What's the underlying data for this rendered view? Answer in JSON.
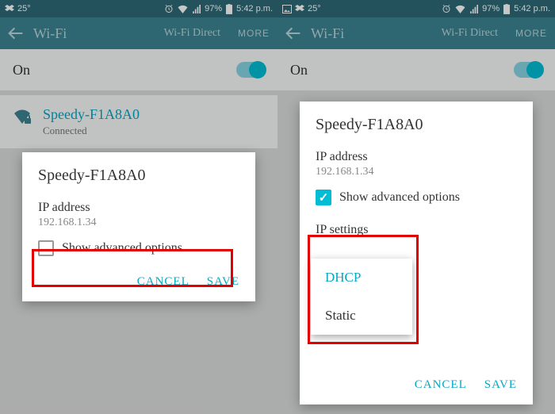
{
  "statusbar": {
    "temp": "25°",
    "battery": "97%",
    "time": "5:42 p.m."
  },
  "header": {
    "title": "Wi-Fi",
    "direct": "Wi-Fi Direct",
    "more": "MORE"
  },
  "toggle": {
    "label": "On"
  },
  "network": {
    "ssid": "Speedy-F1A8A0",
    "status": "Connected"
  },
  "dialog": {
    "title": "Speedy-F1A8A0",
    "ip_label": "IP address",
    "ip_value": "192.168.1.34",
    "checkbox_label": "Show advanced options",
    "ip_settings_label": "IP settings",
    "cancel": "CANCEL",
    "save": "SAVE"
  },
  "dropdown": {
    "opt_dhcp": "DHCP",
    "opt_static": "Static"
  }
}
